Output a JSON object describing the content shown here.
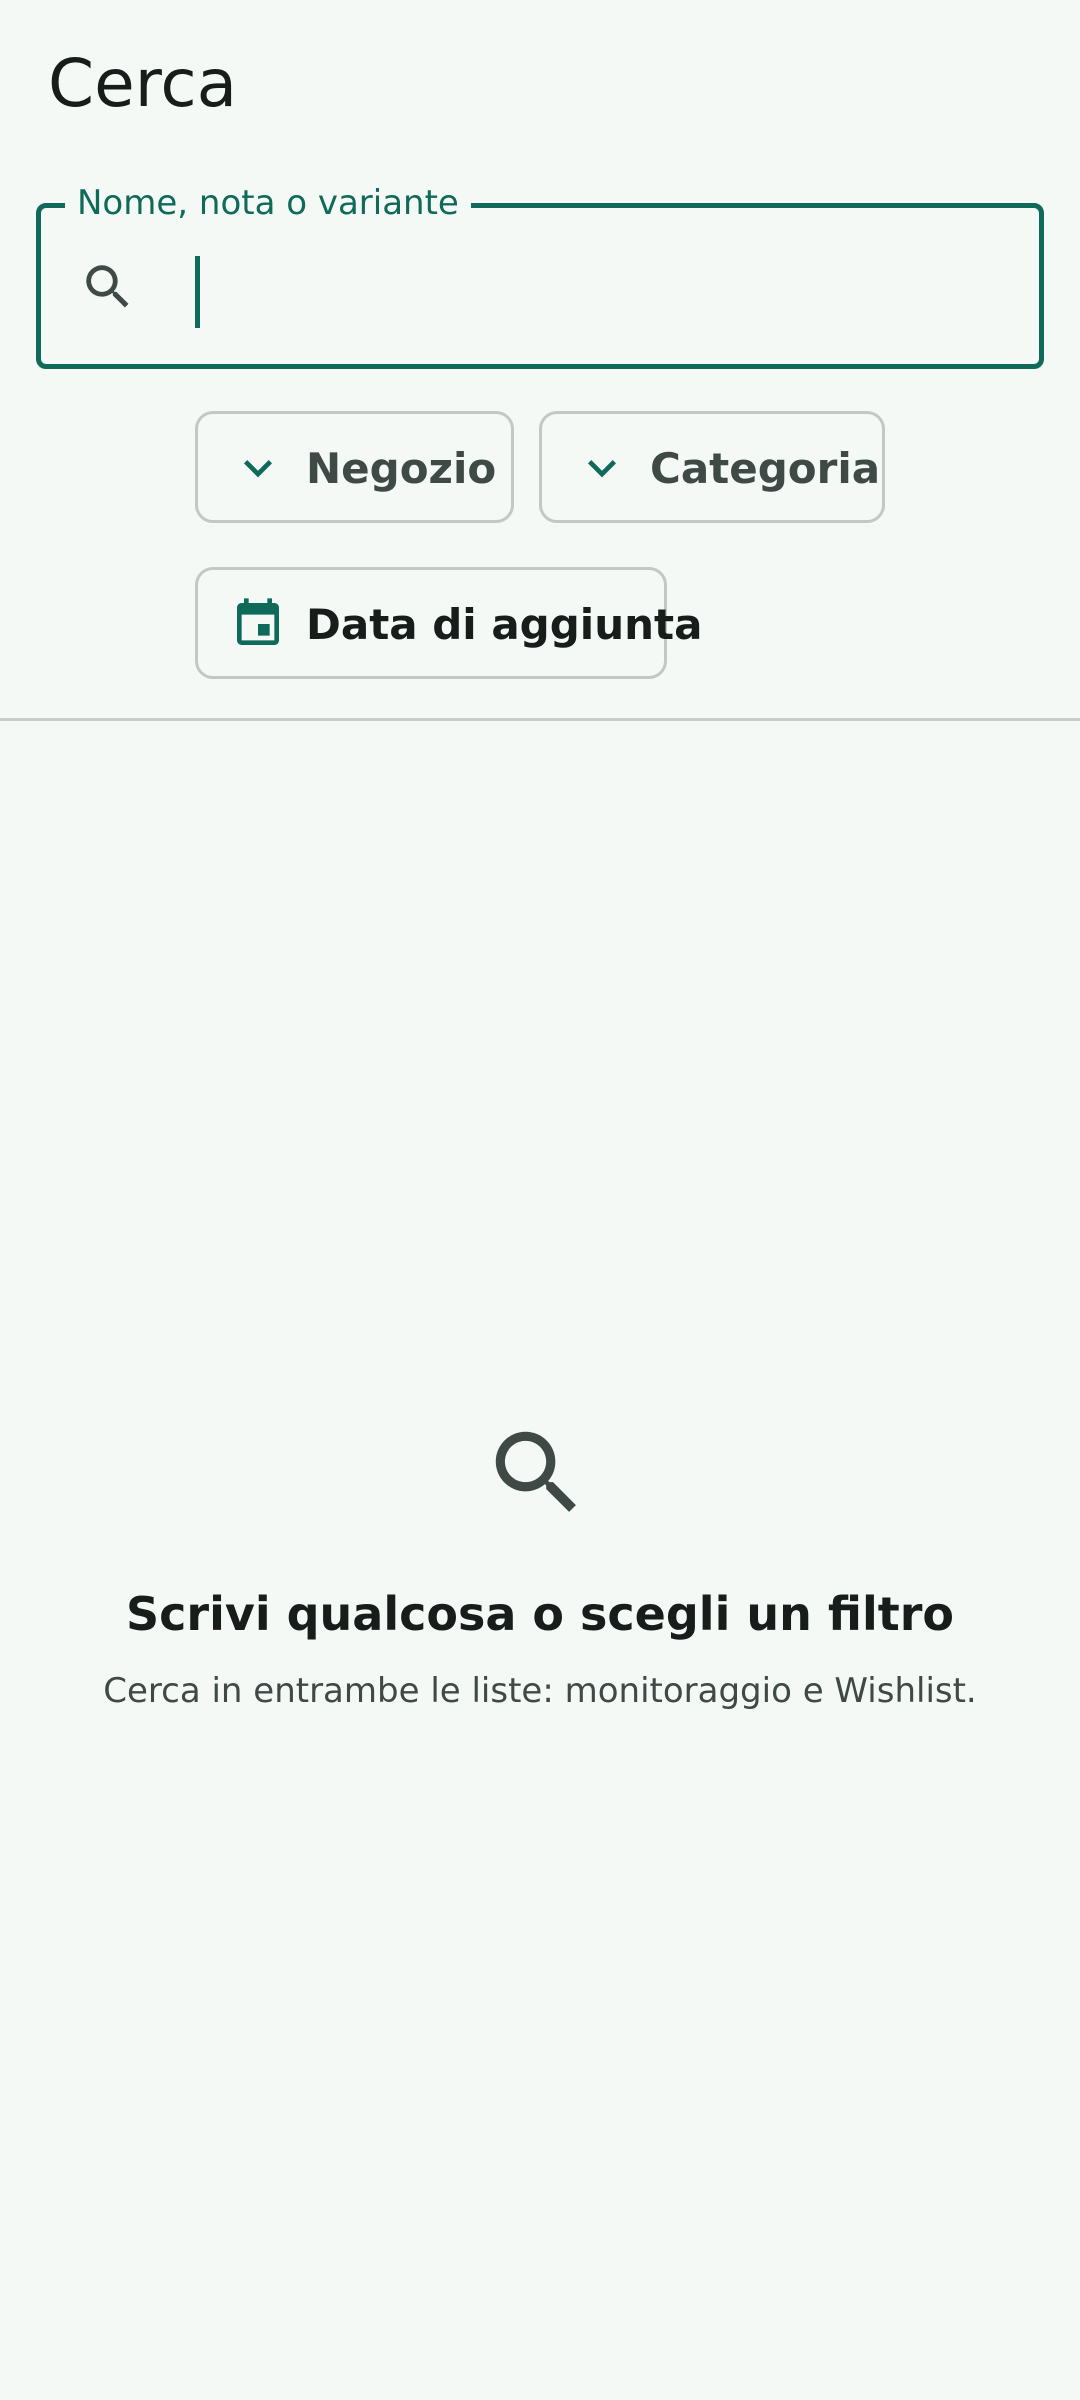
{
  "screen": {
    "title": "Cerca"
  },
  "search": {
    "label": "Nome, nota o variante",
    "value": "",
    "icon": "search-icon"
  },
  "filters": [
    {
      "label": "Negozio",
      "icon": "chevron-down-icon"
    },
    {
      "label": "Categoria",
      "icon": "chevron-down-icon"
    },
    {
      "label": "Data di aggiunta",
      "icon": "calendar-icon"
    }
  ],
  "empty_state": {
    "icon": "search-icon",
    "title": "Scrivi qualcosa o scegli un filtro",
    "subtitle": "Cerca in entrambe le liste: monitoraggio e Wishlist."
  },
  "colors": {
    "background": "#f4f9f6",
    "accent": "#0f6a59",
    "text_primary": "#171d1a",
    "text_secondary": "#3f4945",
    "outline": "#c2c8c4"
  }
}
